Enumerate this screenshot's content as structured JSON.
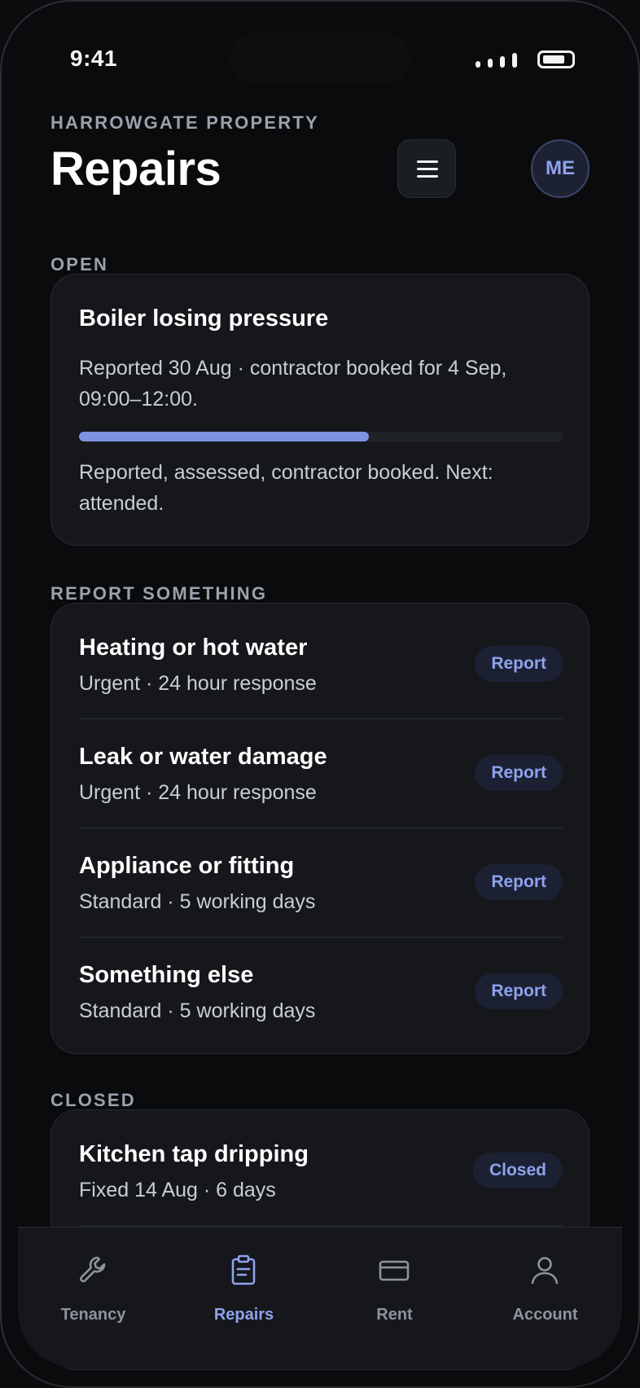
{
  "status_bar": {
    "time": "9:41"
  },
  "header": {
    "eyebrow": "HARROWGATE PROPERTY",
    "title": "Repairs",
    "avatar_initials": "ME"
  },
  "open_section": {
    "label": "OPEN",
    "repair": {
      "title": "Boiler losing pressure",
      "description": "Reported 30 Aug · contractor booked for 4 Sep, 09:00–12:00.",
      "progress_fraction": 0.6,
      "steps_text": "Reported, assessed, contractor booked. Next: attended."
    }
  },
  "report_section": {
    "label": "REPORT SOMETHING",
    "items": [
      {
        "title": "Heating or hot water",
        "subtitle": "Urgent · 24 hour response",
        "action": "Report"
      },
      {
        "title": "Leak or water damage",
        "subtitle": "Urgent · 24 hour response",
        "action": "Report"
      },
      {
        "title": "Appliance or fitting",
        "subtitle": "Standard · 5 working days",
        "action": "Report"
      },
      {
        "title": "Something else",
        "subtitle": "Standard · 5 working days",
        "action": "Report"
      }
    ]
  },
  "closed_section": {
    "label": "CLOSED",
    "items": [
      {
        "title": "Kitchen tap dripping",
        "subtitle": "Fixed 14 Aug · 6 days",
        "status": "Closed"
      }
    ]
  },
  "tab_bar": {
    "tabs": [
      {
        "label": "Tenancy",
        "icon": "wrench-icon"
      },
      {
        "label": "Repairs",
        "icon": "clipboard-icon",
        "active": true
      },
      {
        "label": "Rent",
        "icon": "card-icon"
      },
      {
        "label": "Account",
        "icon": "person-icon"
      }
    ]
  },
  "colors": {
    "accent": "#8ea2ee",
    "progress": "#7d93e0",
    "card": "#15171b",
    "background": "#0a0b0d"
  }
}
